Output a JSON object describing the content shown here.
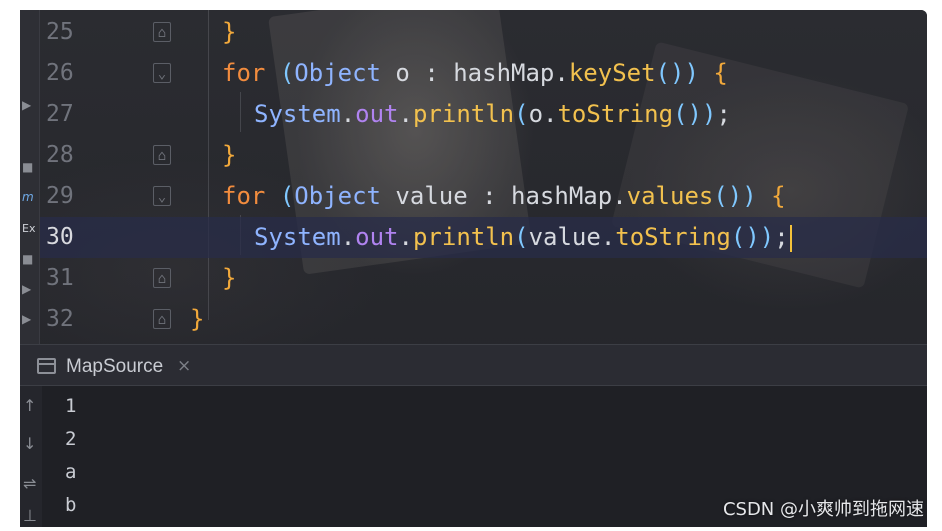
{
  "editor": {
    "lines": [
      {
        "number": "25",
        "current": false
      },
      {
        "number": "26",
        "current": false
      },
      {
        "number": "27",
        "current": false
      },
      {
        "number": "28",
        "current": false
      },
      {
        "number": "29",
        "current": false
      },
      {
        "number": "30",
        "current": true
      },
      {
        "number": "31",
        "current": false
      },
      {
        "number": "32",
        "current": false
      }
    ],
    "code": {
      "l25_brace": "}",
      "l26_for": "for",
      "l26_open": "(",
      "l26_type": "Object",
      "l26_var": "o",
      "l26_colon": ":",
      "l26_map": "hashMap",
      "l26_dot": ".",
      "l26_method": "keySet",
      "l26_parens": "())",
      "l26_brace": "{",
      "l27_sys": "System",
      "l27_dot1": ".",
      "l27_out": "out",
      "l27_dot2": ".",
      "l27_println": "println",
      "l27_open": "(",
      "l27_arg": "o",
      "l27_dot3": ".",
      "l27_tostring": "toString",
      "l27_close": "())",
      "l27_semi": ";",
      "l28_brace": "}",
      "l29_for": "for",
      "l29_open": "(",
      "l29_type": "Object",
      "l29_var": "value",
      "l29_colon": ":",
      "l29_map": "hashMap",
      "l29_dot": ".",
      "l29_method": "values",
      "l29_parens": "())",
      "l29_brace": "{",
      "l30_sys": "System",
      "l30_dot1": ".",
      "l30_out": "out",
      "l30_dot2": ".",
      "l30_println": "println",
      "l30_open": "(",
      "l30_arg": "value",
      "l30_dot3": ".",
      "l30_tostring": "toString",
      "l30_close": "())",
      "l30_semi": ";",
      "l31_brace": "}",
      "l32_brace": "}"
    }
  },
  "left_strip": {
    "items": [
      "▶",
      "■",
      "m",
      "Ex",
      "■",
      "▶",
      "▶"
    ]
  },
  "run_panel": {
    "tab_title": "MapSource",
    "close_glyph": "×",
    "gutter_icons": [
      "↑",
      "↓",
      "⇌",
      "⊥"
    ],
    "output": [
      "1",
      "2",
      "a",
      "b"
    ]
  },
  "watermark": "CSDN @小爽帅到拖网速",
  "colors": {
    "keyword": "#f28c3e",
    "class": "#8fb4ff",
    "method": "#f2c14e",
    "field": "#b083f0",
    "paren": "#80c8ff",
    "brace": "#f2a93b",
    "caret": "#f5c23a"
  }
}
